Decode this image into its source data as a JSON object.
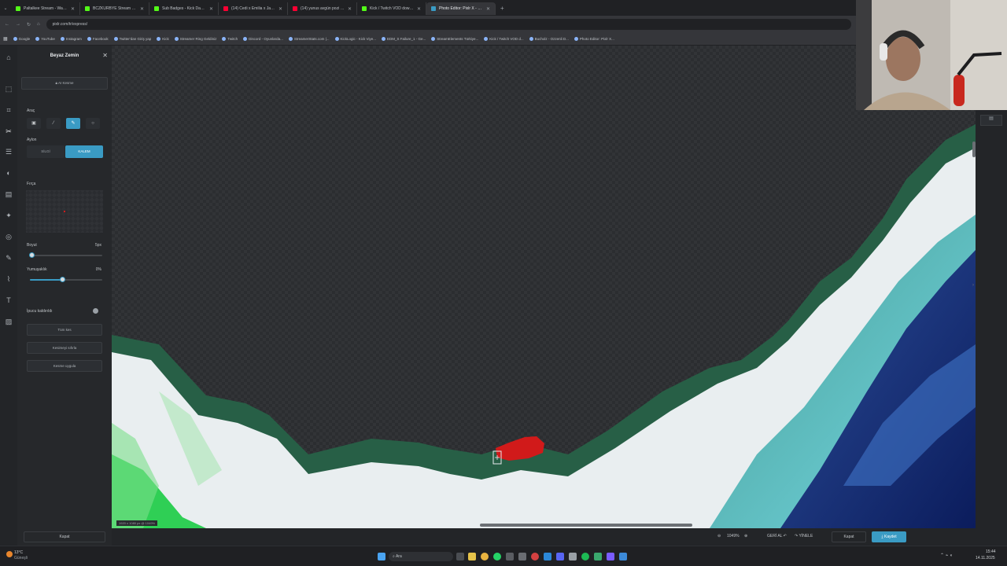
{
  "browser": {
    "tabs": [
      {
        "label": "Paltalkee Stream - Watch Live",
        "color": "#53fc18"
      },
      {
        "label": "BCZKURBYE Stream - Watch li",
        "color": "#53fc18"
      },
      {
        "label": "Sub Badges - Kick Dashboard",
        "color": "#53fc18"
      },
      {
        "label": "(14) Cedi x Emilia x Jay M",
        "color": "#ff0033"
      },
      {
        "label": "(14) yunus avgün pozi pozi - Y",
        "color": "#ff0033"
      },
      {
        "label": "Kick / Twitch VOD downloader",
        "color": "#53fc18"
      },
      {
        "label": "Photo Editor: Pixlr X - çevrimiçi",
        "color": "#3a9bc4",
        "active": true
      }
    ],
    "url": "pixlr.com/tr/express/",
    "bookmarks": [
      "Google",
      "YouTube",
      "Instagram",
      "Facebook",
      "Twitter'dan Giriş yap",
      "Kick",
      "Streamer Ring Geldiniz",
      "Twitch",
      "Discord - Oyunlarda...",
      "StreamerStats.com |...",
      "KickLogic - Kick Viye...",
      "EDM_S Failure_1 - Ge...",
      "StreamElements Türkiye...",
      "Kick / Twitch VOD d...",
      "Bucholz - Ozzenli D...",
      "Photo Editor: Pixlr X..."
    ]
  },
  "panel": {
    "title": "Beyaz Zemin",
    "ai_button": "AI Kesme",
    "tool_label": "Araç",
    "action_label": "Aylon",
    "seg_left": "SİLGİ",
    "seg_right": "KALEM",
    "brush_label": "Fırça",
    "size_label": "Boyut",
    "size_value": "5px",
    "softness_label": "Yumuşaklık",
    "softness_value": "0%",
    "tip_label": "İpucu kaldırıldı",
    "btn1": "Tüm kes",
    "btn2": "Kesimeyi sıfırla",
    "btn3": "Kesme uygula",
    "close_button": "Kapat",
    "size_fraction": 0.02,
    "softness_fraction": 0.45
  },
  "bottom": {
    "zoom": "1049%",
    "undo": "GERİ AL",
    "redo": "YİNELE",
    "close": "Kapat",
    "save": "Kaydet",
    "canvas_info": "1920 x 1080 px @ 1049%"
  },
  "taskbar": {
    "weather": "13°C",
    "weather_desc": "Güneşli",
    "search": "Ara",
    "time": "15:44",
    "date": "14.11.2025"
  },
  "colors": {
    "accent": "#3a9bc4",
    "brush_mark": "#d11a1a"
  }
}
